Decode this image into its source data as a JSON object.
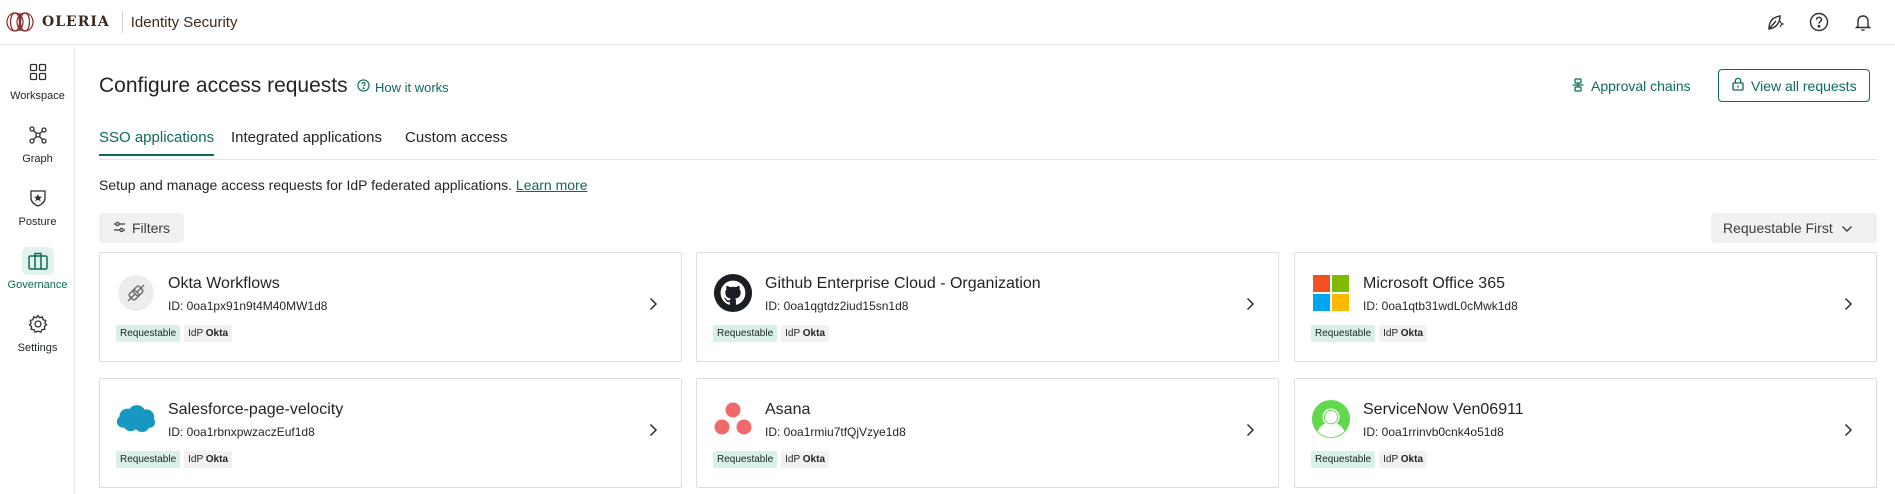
{
  "brand": {
    "name": "OLERIA",
    "product": "Identity Security"
  },
  "topbar": {
    "icons": [
      "leaf-sparkle-icon",
      "help-icon",
      "bell-icon"
    ]
  },
  "nav": {
    "items": [
      {
        "label": "Workspace",
        "icon": "grid-icon",
        "active": false
      },
      {
        "label": "Graph",
        "icon": "graph-icon",
        "active": false
      },
      {
        "label": "Posture",
        "icon": "shield-star-icon",
        "active": false
      },
      {
        "label": "Governance",
        "icon": "briefcase-icon",
        "active": true
      },
      {
        "label": "Settings",
        "icon": "gear-icon",
        "active": false
      }
    ]
  },
  "page": {
    "title": "Configure access requests",
    "how_it_works": "How it works",
    "approval_chains": "Approval chains",
    "view_all": "View all requests",
    "description": "Setup and manage access requests for IdP federated applications.",
    "learn_more": "Learn more",
    "filters": "Filters",
    "sort": "Requestable First"
  },
  "tabs": [
    {
      "label": "SSO applications",
      "active": true
    },
    {
      "label": "Integrated applications",
      "active": false
    },
    {
      "label": "Custom access",
      "active": false
    }
  ],
  "badge_labels": {
    "requestable": "Requestable",
    "idp_prefix": "IdP",
    "idp_name": "Okta"
  },
  "apps": [
    {
      "name": "Okta Workflows",
      "id": "ID: 0oa1px91n9t4M40MW1d8",
      "logo": "plug-icon"
    },
    {
      "name": "Github Enterprise Cloud - Organization",
      "id": "ID: 0oa1qgtdz2iud15sn1d8",
      "logo": "github-icon"
    },
    {
      "name": "Microsoft Office 365",
      "id": "ID: 0oa1qtb31wdL0cMwk1d8",
      "logo": "microsoft-icon"
    },
    {
      "name": "Salesforce-page-velocity",
      "id": "ID: 0oa1rbnxpwzaczEuf1d8",
      "logo": "salesforce-cloud-icon"
    },
    {
      "name": "Asana",
      "id": "ID: 0oa1rmiu7tfQjVzye1d8",
      "logo": "asana-icon"
    },
    {
      "name": "ServiceNow Ven06911",
      "id": "ID: 0oa1rrinvb0cnk4o51d8",
      "logo": "servicenow-icon"
    }
  ],
  "colors": {
    "accent": "#0d6b57",
    "badge_requestable": "#d8f0e9",
    "badge_idp": "#f0f1f0"
  }
}
